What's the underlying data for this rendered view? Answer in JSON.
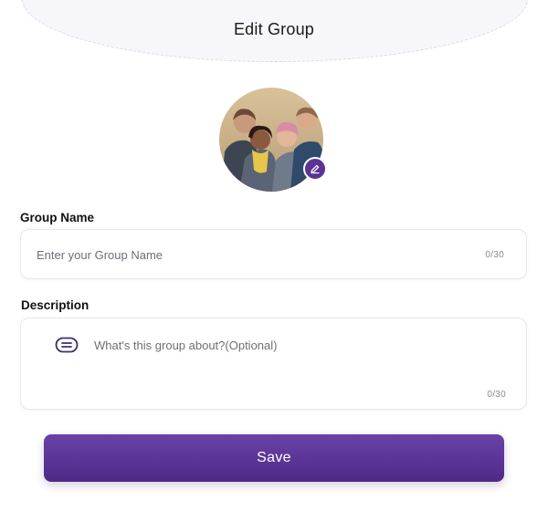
{
  "header": {
    "title": "Edit Group"
  },
  "avatar": {
    "edit_icon": "pencil-icon"
  },
  "group_name": {
    "label": "Group Name",
    "placeholder": "Enter your Group Name",
    "value": "",
    "counter": "0/30"
  },
  "description": {
    "label": "Description",
    "placeholder": "What's this group about?(Optional)",
    "value": "",
    "counter": "0/30",
    "icon": "text-lines-icon"
  },
  "save_button": {
    "label": "Save"
  },
  "colors": {
    "accent": "#5a3394",
    "button_top": "#6a42a8",
    "button_bottom": "#4e2a86",
    "field_border": "#e6e6ee"
  }
}
